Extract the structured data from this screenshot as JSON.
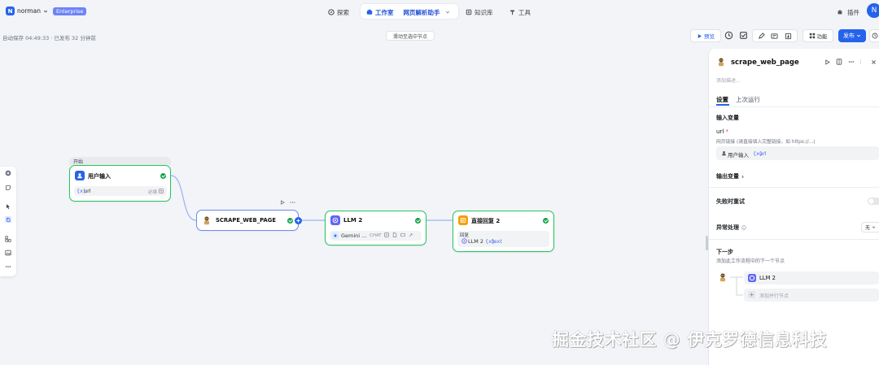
{
  "workspace": {
    "initial": "N",
    "name": "norman",
    "plan": "Enterprise"
  },
  "nav": {
    "explore": "探索",
    "studio": "工作室",
    "app_name": "网页解析助手",
    "knowledge": "知识库",
    "tools": "工具",
    "plugins": "插件",
    "avatar_initial": "N"
  },
  "status": {
    "autosave": "自动保存 04:49:33 · 已发布 32 分钟前"
  },
  "canvas": {
    "hint": "滑动至选中节点"
  },
  "toolbar": {
    "preview": "预览",
    "features": "功能",
    "publish": "发布"
  },
  "nodes": {
    "start": {
      "group_label": "开始",
      "title": "用户输入",
      "var_prefix": "{x}",
      "var_name": "url",
      "required": "必填"
    },
    "scrape": {
      "title": "SCRAPE_WEB_PAGE"
    },
    "llm": {
      "title": "LLM 2",
      "model": "Gemini ...",
      "mode": "CHAT"
    },
    "answer": {
      "title": "直接回复 2",
      "label": "回复",
      "ref_node": "LLM 2",
      "ref_prefix": "{x}",
      "ref_var": "text"
    }
  },
  "panel": {
    "title": "scrape_web_page",
    "description_placeholder": "添加描述...",
    "tabs": [
      "设置",
      "上次运行"
    ],
    "active_tab": 0,
    "input_vars_heading": "输入变量",
    "field_name": "url",
    "required_mark": "*",
    "field_help": "网页链接 (请直接填入完整链接，如 https://...)",
    "field_value_source": "用户输入",
    "field_value_prefix": "{x}",
    "field_value_var": "url",
    "output_vars_heading": "输出变量",
    "retry_label": "失败时重试",
    "error_label": "异常处理",
    "error_value": "无",
    "next_heading": "下一步",
    "next_desc": "添加此工作流程中的下一个节点",
    "next_node": "LLM 2",
    "add_parallel": "添加并行节点"
  },
  "watermark": "掘金技术社区 @ 伊克罗德信息科技",
  "colors": {
    "accent": "#2563eb",
    "success": "#16a34a",
    "node_selected_border": "#6b8cf5",
    "llm_icon": "#6366f1",
    "answer_icon": "#f59e0b",
    "start_icon": "#2563eb",
    "enterprise_badge": "#6e83f5"
  }
}
